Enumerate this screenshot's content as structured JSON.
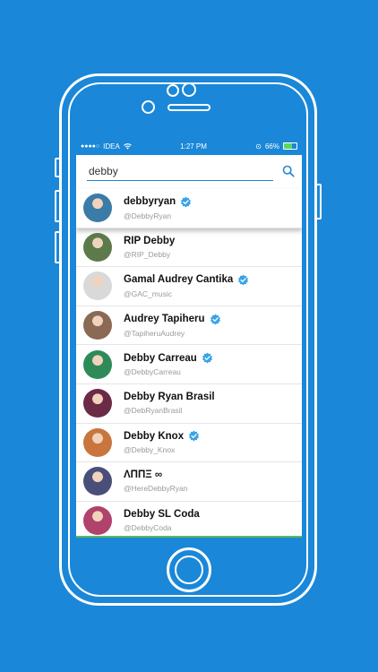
{
  "status_bar": {
    "signal_dots": "●●●●○",
    "carrier": "IDEA",
    "time": "1:27 PM",
    "battery_percent": "66%",
    "battery_level": 0.66
  },
  "search": {
    "value": "debby"
  },
  "results": [
    {
      "name": "debbyryan",
      "handle": "@DebbyRyan",
      "verified": true,
      "avatar_color": "#3a7ba8"
    },
    {
      "name": "RIP Debby",
      "handle": "@RIP_Debby",
      "verified": false,
      "avatar_color": "#5d7a4b"
    },
    {
      "name": "Gamal Audrey Cantika",
      "handle": "@GAC_music",
      "verified": true,
      "avatar_color": "#d9d9d9"
    },
    {
      "name": "Audrey Tapiheru",
      "handle": "@TapiheruAudrey",
      "verified": true,
      "avatar_color": "#8a6a55"
    },
    {
      "name": "Debby Carreau",
      "handle": "@DebbyCarreau",
      "verified": true,
      "avatar_color": "#2e8b57"
    },
    {
      "name": "Debby Ryan Brasil",
      "handle": "@DebRyanBrasil",
      "verified": false,
      "avatar_color": "#6b2a45"
    },
    {
      "name": "Debby Knox",
      "handle": "@Debby_Knox",
      "verified": true,
      "avatar_color": "#c8763e"
    },
    {
      "name": "ΛΠΠΞ ∞",
      "handle": "@HereDebbyRyan",
      "verified": false,
      "avatar_color": "#4a4f7a"
    },
    {
      "name": "Debby SL Coda",
      "handle": "@DebbyCoda",
      "verified": false,
      "avatar_color": "#b0426b"
    }
  ],
  "colors": {
    "accent": "#1a87d8",
    "verified": "#3aa3e8"
  }
}
